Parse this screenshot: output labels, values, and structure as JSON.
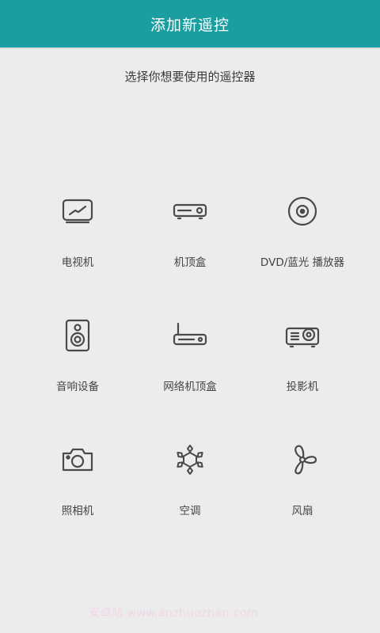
{
  "header": {
    "title": "添加新遥控"
  },
  "subtitle": "选择你想要使用的遥控器",
  "devices": [
    {
      "label": "电视机",
      "icon": "tv-icon"
    },
    {
      "label": "机顶盒",
      "icon": "set-top-box-icon"
    },
    {
      "label": "DVD/蓝光 播放器",
      "icon": "disc-icon"
    },
    {
      "label": "音响设备",
      "icon": "speaker-icon"
    },
    {
      "label": "网络机顶盒",
      "icon": "router-icon"
    },
    {
      "label": "投影机",
      "icon": "projector-icon"
    },
    {
      "label": "照相机",
      "icon": "camera-icon"
    },
    {
      "label": "空调",
      "icon": "snowflake-icon"
    },
    {
      "label": "风扇",
      "icon": "fan-icon"
    }
  ],
  "colors": {
    "header_bg": "#1a9e9f",
    "page_bg": "#ececec",
    "icon_stroke": "#4a4a4a"
  },
  "watermark": "安卓站 www.anzhuozhan.com"
}
